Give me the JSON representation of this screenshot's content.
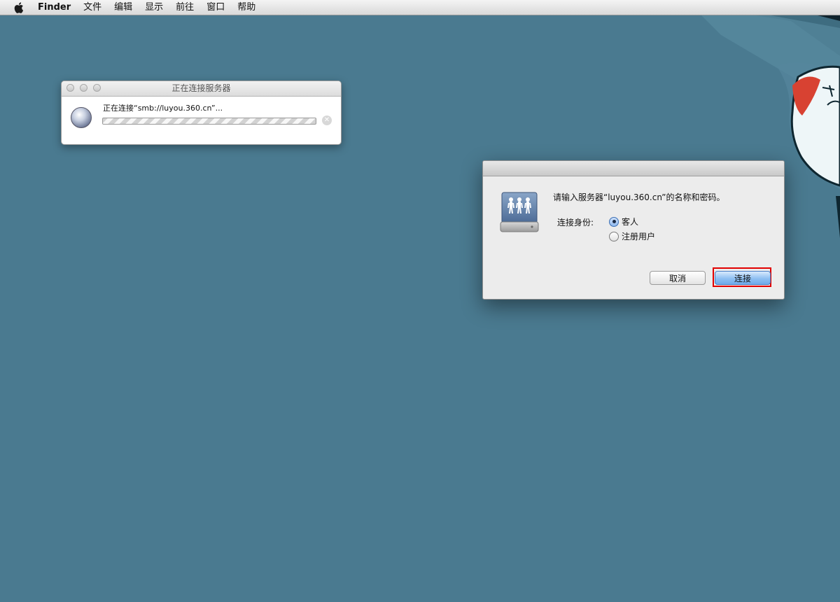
{
  "menubar": {
    "apple": "apple-icon",
    "app_name": "Finder",
    "items": [
      "文件",
      "编辑",
      "显示",
      "前往",
      "窗口",
      "帮助"
    ]
  },
  "progress_window": {
    "title": "正在连接服务器",
    "status": "正在连接“smb://luyou.360.cn”...",
    "icon": "network-globe-icon"
  },
  "login_dialog": {
    "icon": "shared-server-icon",
    "prompt": "请输入服务器“luyou.360.cn”的名称和密码。",
    "connect_as_label": "连接身份:",
    "options": [
      {
        "label": "客人",
        "selected": true
      },
      {
        "label": "注册用户",
        "selected": false
      }
    ],
    "cancel_button": "取消",
    "connect_button": "连接"
  },
  "colors": {
    "desktop": "#4a7a90",
    "highlight": "#e10000",
    "default_button": "#8fc0f2"
  }
}
